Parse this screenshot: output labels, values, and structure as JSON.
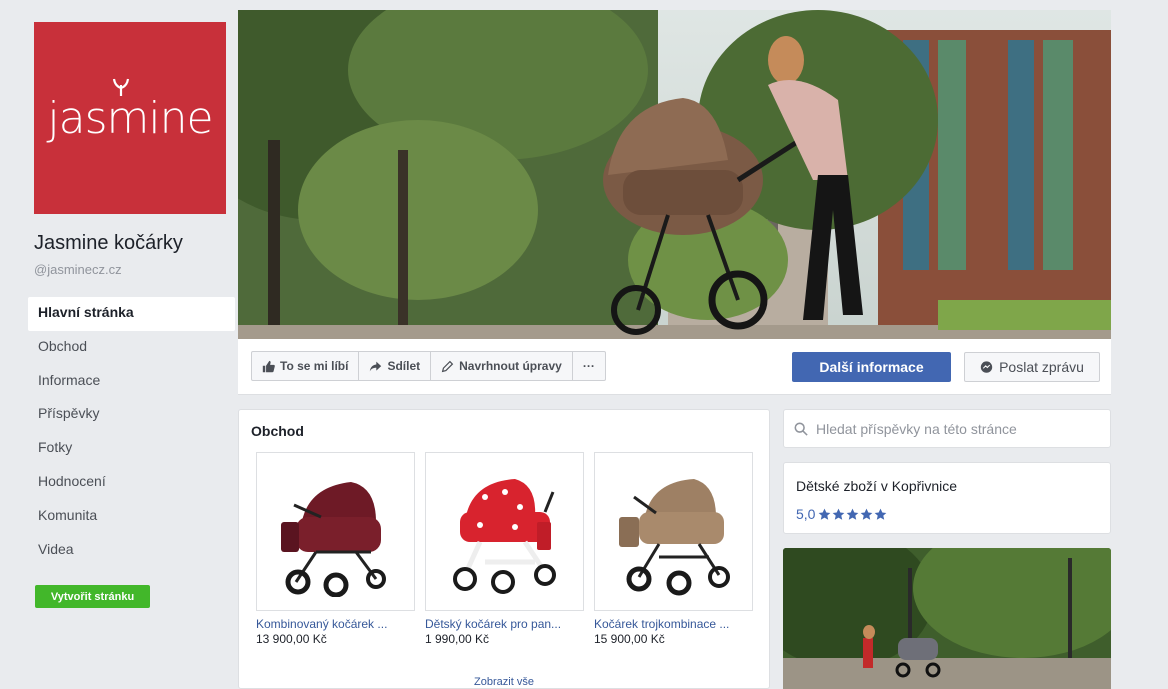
{
  "page": {
    "logo_text": "jasmine",
    "name": "Jasmine kočárky",
    "handle": "@jasminecz.cz"
  },
  "nav": {
    "items": [
      {
        "label": "Hlavní stránka",
        "active": true
      },
      {
        "label": "Obchod"
      },
      {
        "label": "Informace"
      },
      {
        "label": "Příspěvky"
      },
      {
        "label": "Fotky"
      },
      {
        "label": "Hodnocení"
      },
      {
        "label": "Komunita"
      },
      {
        "label": "Videa"
      }
    ],
    "create_page_label": "Vytvořit stránku"
  },
  "actions": {
    "like_label": "To se mi líbí",
    "share_label": "Sdílet",
    "suggest_label": "Navrhnout úpravy",
    "more_label": "···",
    "more_info_label": "Další informace",
    "send_message_label": "Poslat zprávu"
  },
  "shop": {
    "title": "Obchod",
    "products": [
      {
        "name": "Kombinovaný kočárek ...",
        "price": "13 900,00 Kč",
        "color": "#7a1f2b"
      },
      {
        "name": "Dětský kočárek pro pan...",
        "price": "1 990,00 Kč",
        "color": "#d8232e"
      },
      {
        "name": "Kočárek trojkombinace ...",
        "price": "15 900,00 Kč",
        "color": "#a98a6c"
      }
    ],
    "show_all_label": "Zobrazit vše"
  },
  "sidebar": {
    "search_placeholder": "Hledat příspěvky na této stránce",
    "category": "Dětské zboží v Kopřivnice",
    "rating": "5,0",
    "rating_stars": 5
  },
  "colors": {
    "brand_red": "#c8303a",
    "fb_blue": "#4267b2",
    "link_blue": "#365899",
    "create_green": "#42b72a"
  }
}
